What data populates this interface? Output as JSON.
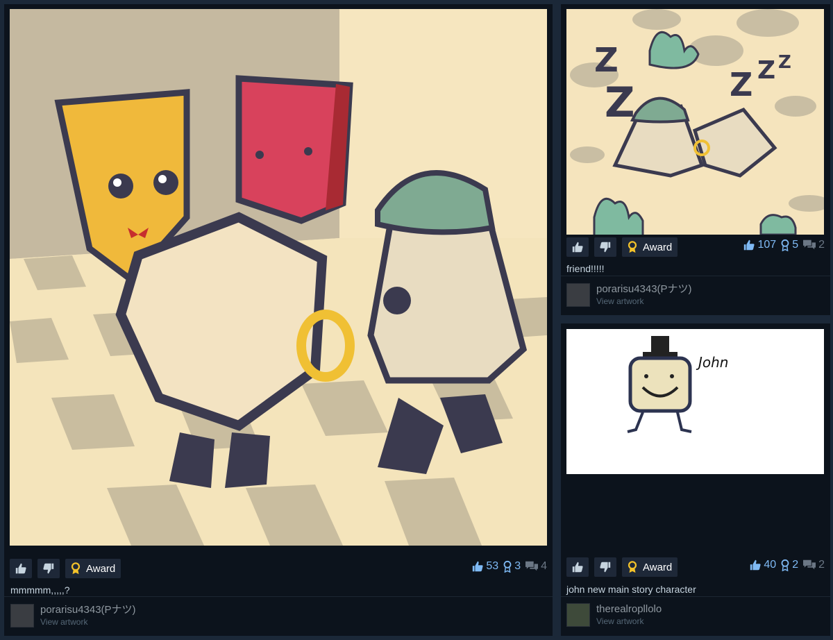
{
  "cards": [
    {
      "vote_up": "thumbs-up-icon",
      "vote_down": "thumbs-down-icon",
      "award_label": "Award",
      "likes": "53",
      "awards": "3",
      "comments": "4",
      "caption": "mmmmm,,,,,?",
      "author": "porarisu4343(Pナツ)",
      "view_label": "View artwork"
    },
    {
      "vote_up": "thumbs-up-icon",
      "vote_down": "thumbs-down-icon",
      "award_label": "Award",
      "likes": "107",
      "awards": "5",
      "comments": "2",
      "caption": "friend!!!!!",
      "author": "porarisu4343(Pナツ)",
      "view_label": "View artwork"
    },
    {
      "vote_up": "thumbs-up-icon",
      "vote_down": "thumbs-down-icon",
      "award_label": "Award",
      "likes": "40",
      "awards": "2",
      "comments": "2",
      "caption": "john new main story character",
      "author": "therealropllolo",
      "view_label": "View artwork",
      "art_text": "John"
    }
  ],
  "colors": {
    "background": "#1b2838",
    "card": "#0c131c",
    "count_blue": "#7fbaf5",
    "award_gold": "#f3c22a"
  }
}
